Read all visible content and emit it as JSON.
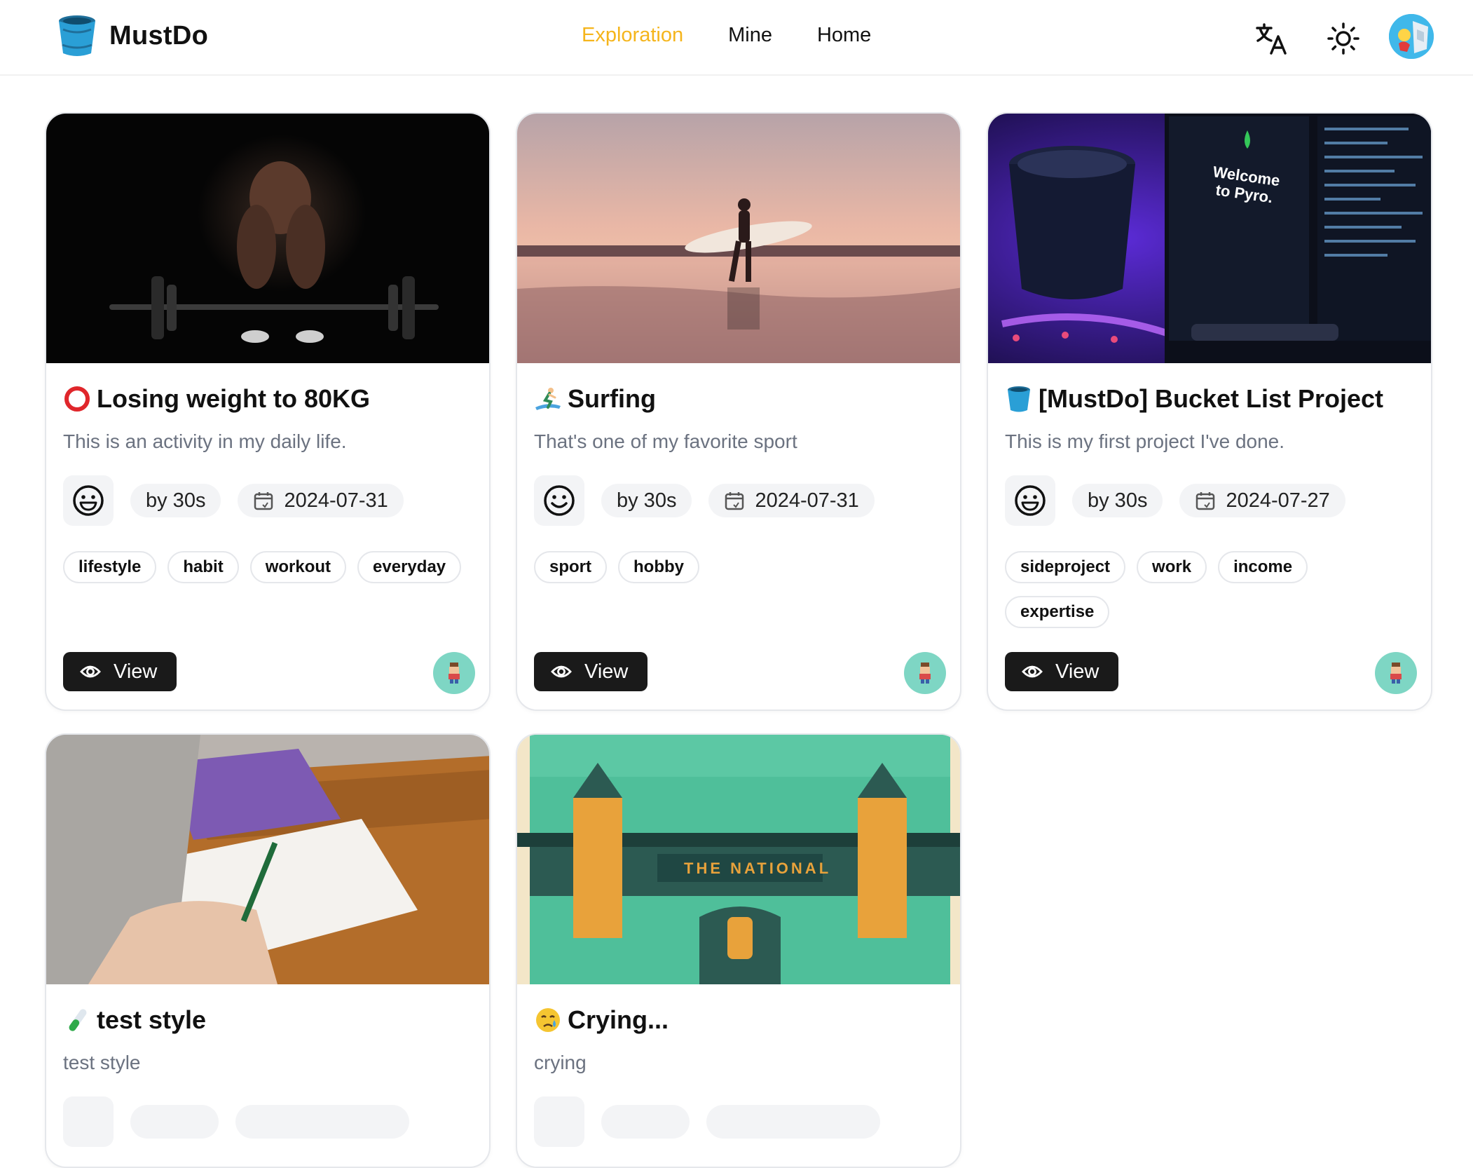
{
  "app": {
    "name": "MustDo",
    "logo_icon": "bucket-icon"
  },
  "nav": {
    "items": [
      {
        "label": "Exploration",
        "active": true
      },
      {
        "label": "Mine",
        "active": false
      },
      {
        "label": "Home",
        "active": false
      }
    ]
  },
  "header_actions": {
    "language_icon": "translate-icon",
    "theme_icon": "sun-icon",
    "avatar": "user-avatar"
  },
  "colors": {
    "accent": "#f5b51c",
    "button_dark": "#1a1a1a",
    "chip_bg": "#f3f4f6",
    "muted_text": "#6b7280",
    "owner_avatar_bg": "#7ed6c4"
  },
  "cards": [
    {
      "emoji": "red-circle-icon",
      "title": "Losing weight to 80KG",
      "description": "This is an activity in my daily life.",
      "mood": "grinning-face-icon",
      "author": "by 30s",
      "date": "2024-07-31",
      "tags": [
        "lifestyle",
        "habit",
        "workout",
        "everyday"
      ],
      "view_label": "View",
      "image": "weightlifting-photo"
    },
    {
      "emoji": "surfer-icon",
      "title": "Surfing",
      "description": "That's one of my favorite sport",
      "mood": "smiling-face-icon",
      "author": "by 30s",
      "date": "2024-07-31",
      "tags": [
        "sport",
        "hobby"
      ],
      "view_label": "View",
      "image": "surfing-sunset-photo"
    },
    {
      "emoji": "bucket-icon",
      "title": "[MustDo] Bucket List Project",
      "description": "This is my first project I've done.",
      "mood": "grinning-face-icon",
      "author": "by 30s",
      "date": "2024-07-27",
      "tags": [
        "sideproject",
        "work",
        "income",
        "expertise"
      ],
      "view_label": "View",
      "image": "coding-desk-photo"
    },
    {
      "emoji": "test-tube-icon",
      "title": "test style",
      "description": "test style",
      "image": "writing-photo"
    },
    {
      "emoji": "crying-face-icon",
      "title": "Crying...",
      "description": "crying",
      "image": "tower-bridge-poster"
    }
  ]
}
